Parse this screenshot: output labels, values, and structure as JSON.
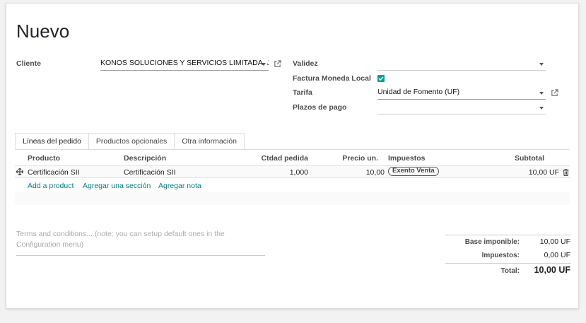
{
  "page": {
    "title": "Nuevo"
  },
  "form": {
    "cliente_label": "Cliente",
    "cliente_value": "KONOS SOLUCIONES Y SERVICIOS LIMITADA, Jo",
    "validez_label": "Validez",
    "validez_value": "",
    "factura_label": "Factura Moneda Local",
    "factura_checked": true,
    "tarifa_label": "Tarifa",
    "tarifa_value": "Unidad de Fomento (UF)",
    "plazos_label": "Plazos de pago",
    "plazos_value": ""
  },
  "tabs": [
    {
      "label": "Líneas del pedido",
      "active": true
    },
    {
      "label": "Productos opcionales",
      "active": false
    },
    {
      "label": "Otra información",
      "active": false
    }
  ],
  "table": {
    "headers": {
      "producto": "Producto",
      "descripcion": "Descripción",
      "ctdad": "Ctdad pedida",
      "precio": "Precio un.",
      "impuestos": "Impuestos",
      "subtotal": "Subtotal"
    },
    "rows": [
      {
        "producto": "Certificación SII",
        "descripcion": "Certificación SII",
        "ctdad": "1,000",
        "precio": "10,00",
        "impuesto": "Exento Venta",
        "subtotal": "10,00 UF"
      }
    ],
    "actions": {
      "add_product": "Add a product",
      "add_section": "Agregar una sección",
      "add_note": "Agregar nota"
    }
  },
  "terms": {
    "placeholder": "Terms and conditions... (note: you can setup default ones in the Configuration menu)"
  },
  "totals": {
    "base_label": "Base imponible:",
    "base_value": "10,00 UF",
    "impuestos_label": "Impuestos:",
    "impuestos_value": "0,00 UF",
    "total_label": "Total:",
    "total_value": "10,00 UF"
  },
  "colors": {
    "accent": "#00a09d",
    "link": "#017e84"
  }
}
